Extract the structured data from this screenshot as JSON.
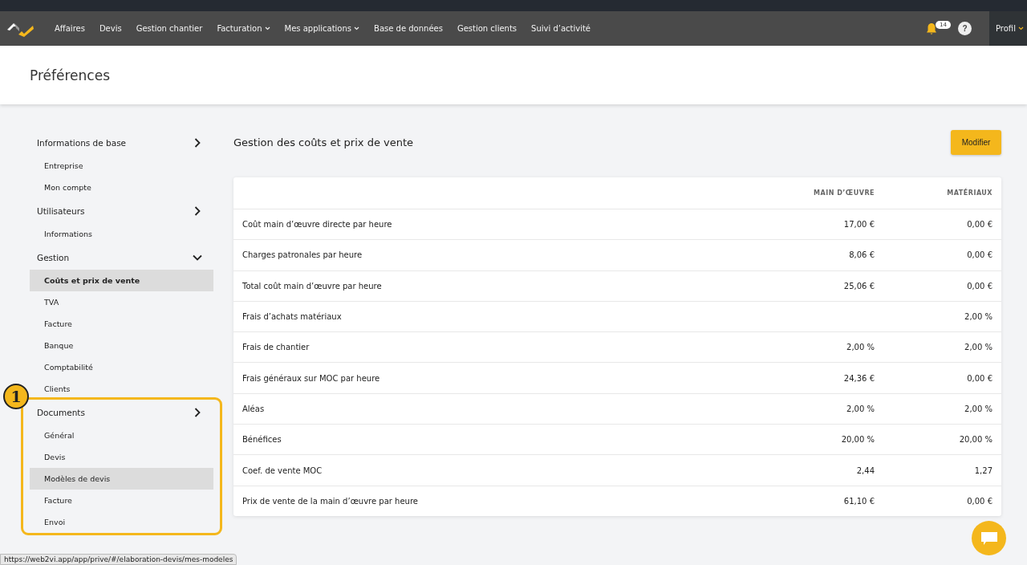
{
  "nav": {
    "items": [
      {
        "label": "Affaires",
        "dropdown": false
      },
      {
        "label": "Devis",
        "dropdown": false
      },
      {
        "label": "Gestion chantier",
        "dropdown": false
      },
      {
        "label": "Facturation",
        "dropdown": true
      },
      {
        "label": "Mes applications",
        "dropdown": true
      },
      {
        "label": "Base de données",
        "dropdown": false
      },
      {
        "label": "Gestion clients",
        "dropdown": false
      },
      {
        "label": "Suivi d’activité",
        "dropdown": false
      }
    ],
    "notifications": "14",
    "help": "?",
    "profile": "Profil"
  },
  "header": {
    "title": "Préférences"
  },
  "sidebar": [
    {
      "label": "Informations de base",
      "expanded": false,
      "children": [
        {
          "label": "Entreprise",
          "selected": false,
          "hovered": false
        },
        {
          "label": "Mon compte",
          "selected": false,
          "hovered": false
        }
      ]
    },
    {
      "label": "Utilisateurs",
      "expanded": false,
      "children": [
        {
          "label": "Informations",
          "selected": false,
          "hovered": false
        }
      ]
    },
    {
      "label": "Gestion",
      "expanded": true,
      "children": [
        {
          "label": "Coûts et prix de vente",
          "selected": true,
          "hovered": false
        },
        {
          "label": "TVA",
          "selected": false,
          "hovered": false
        },
        {
          "label": "Facture",
          "selected": false,
          "hovered": false
        },
        {
          "label": "Banque",
          "selected": false,
          "hovered": false
        },
        {
          "label": "Comptabilité",
          "selected": false,
          "hovered": false
        },
        {
          "label": "Clients",
          "selected": false,
          "hovered": false
        }
      ]
    },
    {
      "label": "Documents",
      "expanded": false,
      "annotation": "1",
      "children": [
        {
          "label": "Général",
          "selected": false,
          "hovered": false
        },
        {
          "label": "Devis",
          "selected": false,
          "hovered": false
        },
        {
          "label": "Modèles de devis",
          "selected": false,
          "hovered": true
        },
        {
          "label": "Facture",
          "selected": false,
          "hovered": false
        },
        {
          "label": "Envoi",
          "selected": false,
          "hovered": false
        }
      ]
    }
  ],
  "content": {
    "title": "Gestion des coûts et prix de vente",
    "button": "Modifier",
    "table": {
      "columns": [
        "MAIN D’ŒUVRE",
        "MATÉRIAUX"
      ],
      "rows": [
        {
          "label": "Coût main d’œuvre directe par heure",
          "values": [
            "17,00 €",
            "0,00 €"
          ]
        },
        {
          "label": "Charges patronales par heure",
          "values": [
            "8,06 €",
            "0,00 €"
          ]
        },
        {
          "label": "Total coût main d’œuvre par heure",
          "values": [
            "25,06 €",
            "0,00 €"
          ]
        },
        {
          "label": "Frais d’achats matériaux",
          "materiaux": "2,00 %"
        },
        {
          "label": "Frais de chantier",
          "values": [
            "2,00 %",
            "2,00 %"
          ]
        },
        {
          "label": "Frais généraux sur MOC par heure",
          "values": [
            "24,36 €",
            "0,00 €"
          ]
        },
        {
          "label": "Aléas",
          "values": [
            "2,00 %",
            "2,00 %"
          ]
        },
        {
          "label": "Bénéfices",
          "values": [
            "20,00 %",
            "20,00 %"
          ]
        },
        {
          "label": "Coef. de vente MOC",
          "values": [
            "2,44",
            "1,27"
          ]
        },
        {
          "label": "Prix de vente de la main d’œuvre par heure",
          "values": [
            "61,10 €",
            "0,00 €"
          ]
        }
      ]
    }
  },
  "status_bar": {
    "url": "https://web2vi.app/app/prive/#/elaboration-devis/mes-modeles"
  }
}
